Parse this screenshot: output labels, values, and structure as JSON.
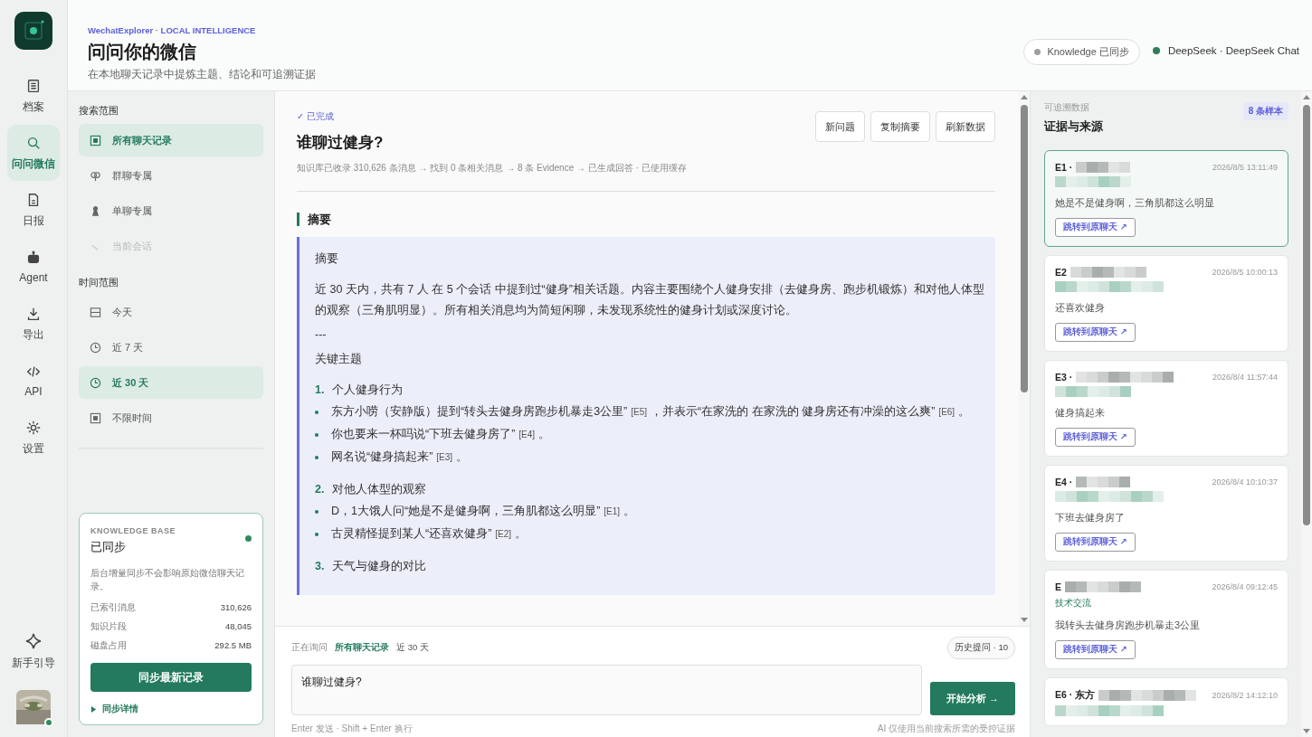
{
  "nav": {
    "items": [
      {
        "label": "档案",
        "selected": false
      },
      {
        "label": "问问微信",
        "selected": true
      },
      {
        "label": "日报",
        "selected": false
      },
      {
        "label": "Agent",
        "selected": false
      },
      {
        "label": "导出",
        "selected": false
      },
      {
        "label": "API",
        "selected": false
      },
      {
        "label": "设置",
        "selected": false
      }
    ],
    "guide": {
      "label": "新手引导"
    },
    "avatar": {
      "online": true
    }
  },
  "header": {
    "eyebrow": "WechatExplorer · LOCAL INTELLIGENCE",
    "title": "问问你的微信",
    "subtitle": "在本地聊天记录中提炼主题、结论和可追溯证据",
    "status": [
      {
        "kind": "pill",
        "label": "Knowledge 已同步",
        "color": "#9e9e9e"
      },
      {
        "kind": "plain",
        "label": "DeepSeek · DeepSeek Chat",
        "color": "#2e7d5b"
      }
    ]
  },
  "filters": [
    {
      "title": "搜索范围",
      "items": [
        {
          "label": "所有聊天记录",
          "selected": true,
          "disabled": false
        },
        {
          "label": "群聊专属",
          "selected": false,
          "disabled": false
        },
        {
          "label": "单聊专属",
          "selected": false,
          "disabled": false
        },
        {
          "label": "当前会话",
          "selected": false,
          "disabled": true
        }
      ]
    },
    {
      "title": "时间范围",
      "items": [
        {
          "label": "今天",
          "selected": false,
          "disabled": false
        },
        {
          "label": "近 7 天",
          "selected": false,
          "disabled": false
        },
        {
          "label": "近 30 天",
          "selected": true,
          "disabled": false
        },
        {
          "label": "不限时间",
          "selected": false,
          "disabled": false
        }
      ]
    }
  ],
  "knowledge_base": {
    "eyebrow": "KNOWLEDGE BASE",
    "title": "已同步",
    "synced": true,
    "description": "后台增量同步不会影响原始微信聊天记录。",
    "stats": [
      {
        "label": "已索引消息",
        "value": "310,626"
      },
      {
        "label": "知识片段",
        "value": "48,045"
      },
      {
        "label": "磁盘占用",
        "value": "292.5 MB"
      }
    ],
    "button": "同步最新记录",
    "details": "同步详情"
  },
  "answer": {
    "status": "✓ 已完成",
    "title": "谁聊过健身?",
    "actions": [
      "新问题",
      "复制摘要",
      "刷新数据"
    ],
    "pipeline": "知识库已收录 310,626 条消息 → 找到 0 条相关消息 → 8 条 Evidence → 已生成回答 · 已使用缓存",
    "section": "摘要",
    "summary": {
      "heading": "摘要",
      "paragraph": "近 30 天内，共有 7 人 在 5 个会话 中提到过“健身”相关话题。内容主要围绕个人健身安排（去健身房、跑步机锻炼）和对他人体型的观察（三角肌明显）。所有相关消息均为简短闲聊，未发现系统性的健身计划或深度讨论。",
      "separator": "---",
      "topics_heading": "关键主题",
      "topics": [
        {
          "number": "1.",
          "title": "个人健身行为",
          "bullets": [
            [
              {
                "kind": "text",
                "text": "东方小唠（安静版）提到“转头去健身房跑步机暴走3公里”"
              },
              {
                "kind": "cite",
                "text": "[E5]"
              },
              {
                "kind": "text",
                "text": "，并表示“在家洗的 在家洗的 健身房还有冲澡的这么爽”"
              },
              {
                "kind": "cite",
                "text": "[E6]"
              },
              {
                "kind": "text",
                "text": "。"
              }
            ],
            [
              {
                "kind": "text",
                "text": "你也要来一杯吗说“下班去健身房了”"
              },
              {
                "kind": "cite",
                "text": "[E4]"
              },
              {
                "kind": "text",
                "text": "。"
              }
            ],
            [
              {
                "kind": "text",
                "text": "网名说“健身搞起来”"
              },
              {
                "kind": "cite",
                "text": "[E3]"
              },
              {
                "kind": "text",
                "text": "。"
              }
            ]
          ]
        },
        {
          "number": "2.",
          "title": "对他人体型的观察",
          "bullets": [
            [
              {
                "kind": "text",
                "text": "D，1大饿人问“她是不是健身啊，三角肌都这么明显”"
              },
              {
                "kind": "cite",
                "text": "[E1]"
              },
              {
                "kind": "text",
                "text": "。"
              }
            ],
            [
              {
                "kind": "text",
                "text": "古灵精怪提到某人“还喜欢健身”"
              },
              {
                "kind": "cite",
                "text": "[E2]"
              },
              {
                "kind": "text",
                "text": "。"
              }
            ]
          ]
        },
        {
          "number": "3.",
          "title": "天气与健身的对比"
        }
      ]
    }
  },
  "composer": {
    "context_label": "正在询问",
    "scope": "所有聊天记录",
    "range": "近 30 天",
    "history": "历史提问 · 10",
    "value": "谁聊过健身?",
    "submit": "开始分析 →",
    "hint": "Enter 发送 · Shift + Enter 换行",
    "notice": "AI 仅使用当前搜索所需的受控证据"
  },
  "evidence": {
    "eyebrow": "可追溯数据",
    "title": "证据与来源",
    "count": "8 条样本",
    "items": [
      {
        "ref": "E1 ·",
        "time": "2026/8/5 13:11:49",
        "message": "她是不是健身啊，三角肌都这么明显",
        "link": "跳转到原聊天 ↗",
        "selected": true
      },
      {
        "ref": "E2",
        "time": "2026/8/5 10:00:13",
        "message": "还喜欢健身",
        "link": "跳转到原聊天 ↗",
        "selected": false
      },
      {
        "ref": "E3 ·",
        "time": "2026/8/4 11:57:44",
        "message": "健身搞起来",
        "link": "跳转到原聊天 ↗",
        "selected": false
      },
      {
        "ref": "E4 ·",
        "time": "2026/8/4 10:10:37",
        "message": "下班去健身房了",
        "link": "跳转到原聊天 ↗",
        "selected": false
      },
      {
        "ref": "E",
        "time": "2026/8/4 09:12:45",
        "group": "技术交流",
        "message": "我转头去健身房跑步机暴走3公里",
        "link": "跳转到原聊天 ↗",
        "selected": false
      },
      {
        "ref": "E6 · 东方",
        "time": "2026/8/2 14:12:10",
        "selected": false
      }
    ]
  }
}
